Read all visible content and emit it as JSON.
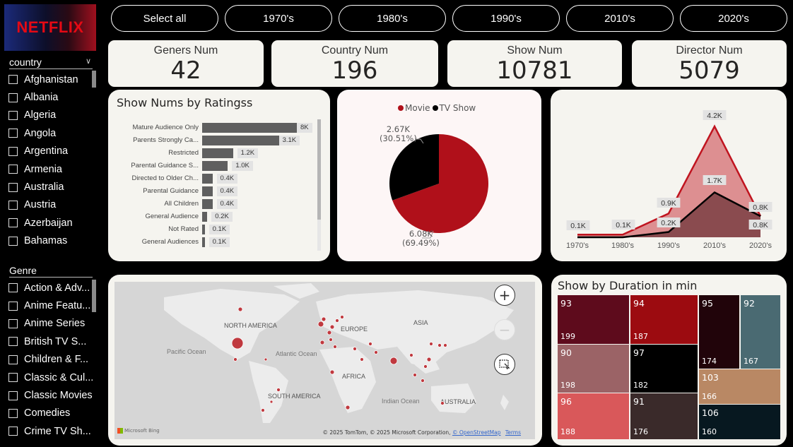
{
  "brand": {
    "logo_text": "NETFLIX"
  },
  "decades": [
    "Select all",
    "1970's",
    "1980's",
    "1990's",
    "2010's",
    "2020's"
  ],
  "country_slicer": {
    "title": "country",
    "items": [
      "Afghanistan",
      "Albania",
      "Algeria",
      "Angola",
      "Argentina",
      "Armenia",
      "Australia",
      "Austria",
      "Azerbaijan",
      "Bahamas"
    ]
  },
  "genre_slicer": {
    "title": "Genre",
    "items": [
      "Action & Adv...",
      "Anime Featu...",
      "Anime Series",
      "British TV S...",
      "Children & F...",
      "Classic & Cul...",
      "Classic Movies",
      "Comedies",
      "Crime TV Sh..."
    ]
  },
  "kpis": [
    {
      "label": "Geners Num",
      "value": "42"
    },
    {
      "label": "Country Num",
      "value": "196"
    },
    {
      "label": "Show Num",
      "value": "10781"
    },
    {
      "label": "Director Num",
      "value": "5079"
    }
  ],
  "ratings_chart": {
    "title": "Show Nums by Ratingss"
  },
  "pie_chart": {
    "legend": [
      {
        "name": "Movie",
        "color": "#b0101a"
      },
      {
        "name": "TV Show",
        "color": "#000000"
      }
    ],
    "tv_label": "2.67K",
    "tv_pct": "(30.51%)",
    "movie_label": "6.08K",
    "movie_pct": "(69.49%)"
  },
  "area_chart": {
    "categories": [
      "1970's",
      "1980's",
      "1990's",
      "2010's",
      "2020's"
    ]
  },
  "map": {
    "continents": [
      "NORTH AMERICA",
      "EUROPE",
      "ASIA",
      "AFRICA",
      "SOUTH AMERICA",
      "AUSTRALIA"
    ],
    "oceans": [
      "Pacific Ocean",
      "Atlantic Ocean",
      "Indian Ocean"
    ],
    "provider": "Microsoft Bing",
    "attribution": "© 2025 TomTom, © 2025 Microsoft Corporation,",
    "osm_link": "© OpenStreetMap",
    "terms_link": "Terms"
  },
  "treemap": {
    "title": "Show by Duration in min",
    "cells": [
      {
        "top": "93",
        "bottom": "199",
        "color": "#5e0b1c"
      },
      {
        "top": "94",
        "bottom": "187",
        "color": "#9c0b10"
      },
      {
        "top": "95",
        "bottom": "174",
        "color": "#21040a"
      },
      {
        "top": "92",
        "bottom": "167",
        "color": "#4a6a72"
      },
      {
        "top": "90",
        "bottom": "198",
        "color": "#9b6366"
      },
      {
        "top": "97",
        "bottom": "182",
        "color": "#000000"
      },
      {
        "top": "103",
        "bottom": "166",
        "color": "#b98864"
      },
      {
        "top": "96",
        "bottom": "188",
        "color": "#d9585a"
      },
      {
        "top": "91",
        "bottom": "176",
        "color": "#3a2a2a"
      },
      {
        "top": "106",
        "bottom": "160",
        "color": "#071820"
      }
    ]
  },
  "chart_data": [
    {
      "type": "bar",
      "title": "Show Nums by Ratingss",
      "categories": [
        "Mature Audience Only",
        "Parents Strongly Ca...",
        "Restricted",
        "Parental Guidance S...",
        "Directed to Older Ch...",
        "Parental Guidance",
        "All Children",
        "General Audience",
        "Not Rated",
        "General Audiences"
      ],
      "values": [
        3800,
        3100,
        1200,
        1000,
        400,
        400,
        400,
        200,
        100,
        100
      ],
      "value_labels": [
        "8K",
        "3.1K",
        "1.2K",
        "1.0K",
        "0.4K",
        "0.4K",
        "0.4K",
        "0.2K",
        "0.1K",
        "0.1K"
      ],
      "orientation": "horizontal"
    },
    {
      "type": "pie",
      "labels": [
        "Movie",
        "TV Show"
      ],
      "values": [
        6080,
        2670
      ],
      "percents": [
        69.49,
        30.51
      ],
      "colors": [
        "#b0101a",
        "#000000"
      ],
      "legend": "top"
    },
    {
      "type": "area",
      "categories": [
        "1970's",
        "1980's",
        "1990's",
        "2010's",
        "2020's"
      ],
      "series": [
        {
          "values": [
            0.1,
            0.1,
            0.9,
            4.2,
            0.8
          ],
          "value_labels": [
            "0.1K",
            "0.1K",
            "0.9K",
            "4.2K",
            "0.8K"
          ],
          "color": "#c0141f"
        },
        {
          "values": [
            0.0,
            0.0,
            0.2,
            1.7,
            0.8
          ],
          "value_labels": [
            "",
            "",
            "0.2K",
            "1.7K",
            "0.8K"
          ],
          "color": "#000000"
        }
      ],
      "unit": "K"
    }
  ]
}
